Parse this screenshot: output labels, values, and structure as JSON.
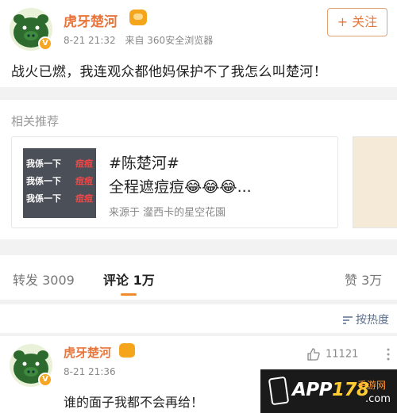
{
  "post": {
    "username": "虎牙楚河",
    "date": "8-21 21:32",
    "source": "来自 360安全浏览器",
    "follow_label": "+ 关注",
    "content": "战火已燃，我连观众都他妈保护不了我怎么叫楚河！"
  },
  "related": {
    "title": "相关推荐",
    "card": {
      "tag": "#陈楚河#",
      "text": "全程遮痘痘😂😂😂...",
      "source": "来源于  瀣西卡的星空花園",
      "thumb_lines": [
        "我係一下",
        "我係一下",
        "我係一下"
      ],
      "thumb_red": [
        "痘痘",
        "痘痘",
        "痘痘"
      ]
    }
  },
  "tabs": {
    "repost": "转发 3009",
    "comments": "评论 1万",
    "likes": "赞 3万"
  },
  "sort": {
    "label": "按热度"
  },
  "comment": {
    "username": "虎牙楚河",
    "date": "8-21 21:36",
    "likes": "11121",
    "text": "谁的面子我都不会再给！"
  },
  "watermark": {
    "app": "APP",
    "num": "178",
    "sub": "手游网",
    "domain": ".com"
  },
  "colors": {
    "accent": "#e8763c",
    "tab_underline": "#f08a2a",
    "vip_badge": "#f4a51c"
  }
}
